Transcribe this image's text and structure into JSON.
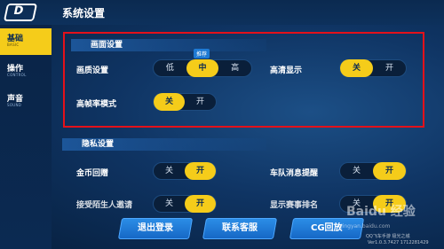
{
  "app": {
    "logo": "D",
    "title": "系统设置"
  },
  "sidebar": {
    "items": [
      {
        "label": "基础",
        "sub": "BASIC",
        "active": true
      },
      {
        "label": "操作",
        "sub": "CONTROL",
        "active": false
      },
      {
        "label": "声音",
        "sub": "SOUND",
        "active": false
      }
    ]
  },
  "display": {
    "header": "画面设置",
    "quality": {
      "label": "画质设置",
      "options": [
        "低",
        "中",
        "高"
      ],
      "selected": "中",
      "badge": "推荐"
    },
    "hd": {
      "label": "高清显示",
      "options": [
        "关",
        "开"
      ],
      "selected": "关"
    },
    "hfr": {
      "label": "高帧率模式",
      "options": [
        "关",
        "开"
      ],
      "selected": "关"
    }
  },
  "privacy": {
    "header": "隐私设置",
    "coin": {
      "label": "金币回赠",
      "options": [
        "关",
        "开"
      ],
      "selected": "开"
    },
    "team": {
      "label": "车队消息提醒",
      "options": [
        "关",
        "开"
      ],
      "selected": "开"
    },
    "row3_left": {
      "label": "接受陌生人邀请",
      "options": [
        "关",
        "开"
      ],
      "selected": "开"
    },
    "row3_right": {
      "label": "显示赛事排名",
      "options": [
        "关",
        "开"
      ],
      "selected": "开"
    }
  },
  "buttons": {
    "logout": "退出登录",
    "service": "联系客服",
    "replay": "CG回放"
  },
  "watermark": {
    "text": "Baidu 经验",
    "url": "jingyan.baidu.com"
  },
  "footer": {
    "version_name": "QQ飞车手游 极光之城",
    "version": "Ver1.0.3.7427 1712281429"
  },
  "colors": {
    "accent": "#f5cc1a",
    "highlight_box": "#e3111a",
    "button": "#1e7ad4"
  }
}
